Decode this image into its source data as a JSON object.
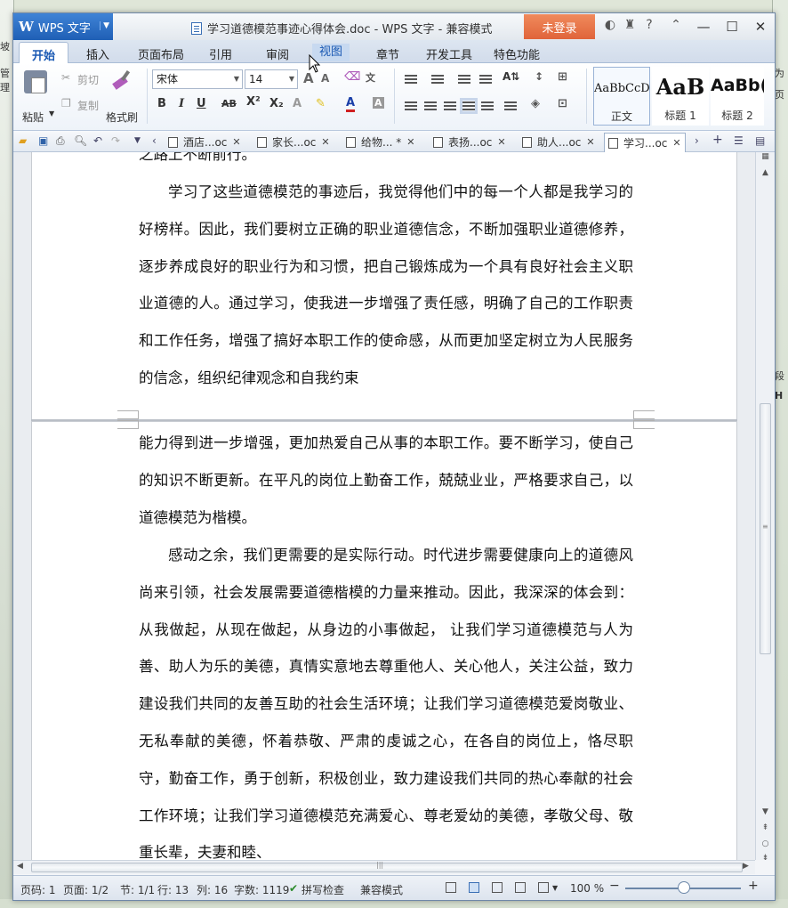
{
  "background": {
    "left_text": [
      "坡",
      "管理"
    ],
    "right_text": [
      "为",
      "页",
      "段",
      "H"
    ]
  },
  "app": {
    "menu_label": "WPS 文字",
    "title": "学习道德模范事迹心得体会.doc - WPS 文字 - 兼容模式",
    "login_label": "未登录"
  },
  "tabs": [
    "开始",
    "插入",
    "页面布局",
    "引用",
    "审阅",
    "视图",
    "章节",
    "开发工具",
    "特色功能"
  ],
  "ribbon": {
    "paste": "粘贴",
    "cut": "剪切",
    "copy": "复制",
    "format_painter": "格式刷",
    "font_name": "宋体",
    "font_size": "14",
    "styles": [
      {
        "sample": "AaBbCcD",
        "label": "正文"
      },
      {
        "sample": "AaB",
        "label": "标题 1"
      },
      {
        "sample": "AaBb(",
        "label": "标题 2"
      }
    ]
  },
  "doc_tabs": [
    {
      "label": "酒店...oc",
      "active": false
    },
    {
      "label": "家长...oc",
      "active": false
    },
    {
      "label": "给物... *",
      "active": false
    },
    {
      "label": "表扬...oc",
      "active": false
    },
    {
      "label": "助人...oc",
      "active": false
    },
    {
      "label": "学习...oc",
      "active": true
    }
  ],
  "document": {
    "page1": {
      "partial_line": "之路上不断前行。",
      "para": "学习了这些道德模范的事迹后，我觉得他们中的每一个人都是我学习的好榜样。因此，我们要树立正确的职业道德信念，不断加强职业道德修养，逐步养成良好的职业行为和习惯，把自己锻炼成为一个具有良好社会主义职业道德的人。通过学习，使我进一步增强了责任感，明确了自己的工作职责和工作任务，增强了搞好本职工作的使命感，从而更加坚定树立为人民服务的信念，组织纪律观念和自我约束"
    },
    "page2": {
      "cont": "能力得到进一步增强，更加热爱自己从事的本职工作。要不断学习，使自己的知识不断更新。在平凡的岗位上勤奋工作，兢兢业业，严格要求自己，以道德模范为楷模。",
      "para": "感动之余，我们更需要的是实际行动。时代进步需要健康向上的道德风尚来引领，社会发展需要道德楷模的力量来推动。因此，我深深的体会到：从我做起，从现在做起，从身边的小事做起， 让我们学习道德模范与人为善、助人为乐的美德，真情实意地去尊重他人、关心他人，关注公益，致力建设我们共同的友善互助的社会生活环境；让我们学习道德模范爱岗敬业、无私奉献的美德，怀着恭敬、严肃的虔诚之心，在各自的岗位上，恪尽职守，勤奋工作，勇于创新，积极创业，致力建设我们共同的热心奉献的社会工作环境；让我们学习道德模范充满爱心、尊老爱幼的美德，孝敬父母、敬重长辈，夫妻和睦、"
    }
  },
  "status": {
    "page_num": "页码: 1",
    "pages": "页面: 1/2",
    "section": "节: 1/1",
    "row": "行: 13",
    "col": "列: 16",
    "words": "字数: 1119",
    "spell": "拼写检查",
    "mode": "兼容模式",
    "zoom": "100 %"
  }
}
